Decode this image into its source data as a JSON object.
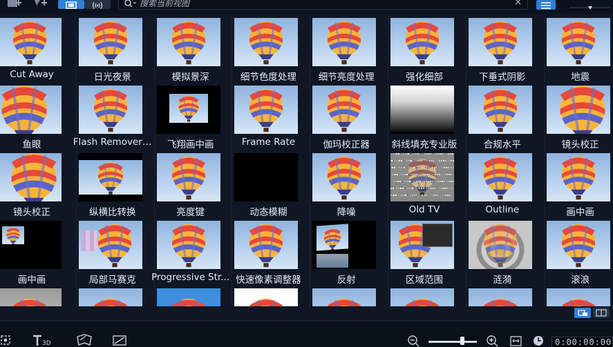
{
  "search": {
    "placeholder": "搜索当前视图"
  },
  "colors": {
    "accent": "#2f7fd9",
    "background": "#0f1624"
  },
  "effects": [
    {
      "label": "Cut Away"
    },
    {
      "label": "日光夜景"
    },
    {
      "label": "模拟景深"
    },
    {
      "label": "细节色度处理"
    },
    {
      "label": "细节亮度处理"
    },
    {
      "label": "强化细部"
    },
    {
      "label": "下垂式阴影"
    },
    {
      "label": "地震"
    },
    {
      "label": "鱼眼"
    },
    {
      "label": "Flash Remover ..."
    },
    {
      "label": "飞翔画中画"
    },
    {
      "label": "Frame Rate"
    },
    {
      "label": "伽玛校正器"
    },
    {
      "label": "斜线填充专业版"
    },
    {
      "label": "合规水平"
    },
    {
      "label": "镜头校正"
    },
    {
      "label": "镜头校正"
    },
    {
      "label": "纵横比转换"
    },
    {
      "label": "亮度键"
    },
    {
      "label": "动态模糊"
    },
    {
      "label": "降噪"
    },
    {
      "label": "Old TV"
    },
    {
      "label": "Outline"
    },
    {
      "label": "画中画"
    },
    {
      "label": "画中画"
    },
    {
      "label": "局部马赛克"
    },
    {
      "label": "Progressive Str..."
    },
    {
      "label": "快速像素调整器"
    },
    {
      "label": "反射"
    },
    {
      "label": "区域范围"
    },
    {
      "label": "涟漪"
    },
    {
      "label": "滚浪"
    }
  ],
  "bottombar": {
    "timecode": "0:00:00:00"
  },
  "icons": [
    "add-media-icon",
    "add-effect-icon",
    "view-mode-icon",
    "audio-wave-icon",
    "search-icon",
    "clear-icon",
    "list-view-icon",
    "capture-icon",
    "title-3d-icon",
    "mask-icon",
    "crop-icon",
    "zoom-out-icon",
    "zoom-in-icon",
    "fit-icon",
    "clock-icon"
  ]
}
